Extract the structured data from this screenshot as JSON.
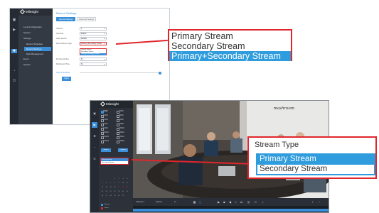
{
  "top_screen": {
    "brand": "Milesight",
    "menu": [
      {
        "label": "Local Configuration",
        "sub": false,
        "active": false
      },
      {
        "label": "System",
        "sub": false,
        "active": false
      },
      {
        "label": "Storage",
        "sub": false,
        "active": false
      },
      {
        "label": "Record Schedule",
        "sub": true,
        "active": false
      },
      {
        "label": "Record Settings",
        "sub": true,
        "active": true
      },
      {
        "label": "Disk Management",
        "sub": true,
        "active": false
      },
      {
        "label": "Event",
        "sub": false,
        "active": false
      },
      {
        "label": "System",
        "sub": false,
        "active": false
      }
    ],
    "page_title": "Record Settings",
    "tabs": [
      "General Settings",
      "Advanced Settings"
    ],
    "fields": [
      {
        "label": "Channel",
        "value": "1"
      },
      {
        "label": "Overwrite",
        "value": "Enable"
      },
      {
        "label": "Audio Record",
        "value": "Disable"
      },
      {
        "label": "Record Stream Type",
        "value": "Primary+Secondary Stream"
      },
      {
        "label": "Pre Record Time",
        "value": "5 s"
      },
      {
        "label": "Post Record Time",
        "value": "5 s"
      }
    ],
    "mini_dropdown": [
      "Primary Stream",
      "Secondary Stream",
      "Primary+Secondary Stream"
    ],
    "copy_label": "Copy to Channels",
    "apply_label": "Apply"
  },
  "top_zoom": {
    "options": [
      "Primary Stream",
      "Secondary Stream",
      "Primary+Secondary Stream"
    ],
    "selected_index": 2
  },
  "bottom_screen": {
    "brand": "Milesight",
    "cameras": [
      "CAM1",
      "CAM2",
      "CAM3",
      "CAM4",
      "CAM5",
      "CAM6",
      "CAM7",
      "CAM8",
      "CAM9",
      "CAM10",
      "CAM11",
      "CAM12",
      "CAM13",
      "CAM14",
      "CAM15",
      "CAM16"
    ],
    "camera_checked_count": 1,
    "buttons": [
      "Search",
      "Playback"
    ],
    "stream_options": [
      "Primary Stream",
      "Secondary Stream"
    ],
    "stream_selected_index": 0,
    "calendar_days": [
      "1",
      "2",
      "3",
      "4",
      "5",
      "6",
      "7",
      "8",
      "9",
      "10",
      "11",
      "12",
      "13",
      "14",
      "15",
      "16",
      "17",
      "18",
      "19",
      "20",
      "21",
      "22",
      "23",
      "24",
      "25",
      "26",
      "27",
      "28",
      "29",
      "30",
      "31"
    ],
    "calendar_marked": [
      "16",
      "17",
      "18"
    ],
    "legend": [
      "Normal",
      "Event"
    ],
    "watermark": "mashroom",
    "controls": {
      "channel": "Channel 1",
      "mode": "Normal",
      "speed": "1x"
    }
  },
  "bottom_zoom": {
    "label": "Stream Type",
    "options": [
      "Primary Stream",
      "Secondary Stream"
    ],
    "selected_index": 0
  },
  "colors": {
    "accent": "#2e9cdd",
    "highlight": "#e0262c",
    "sidebar": "#262b33"
  }
}
